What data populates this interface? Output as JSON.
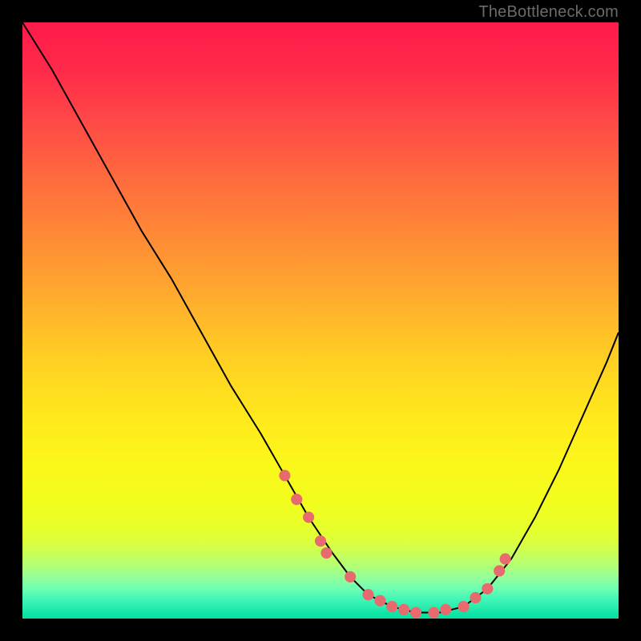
{
  "attribution": "TheBottleneck.com",
  "colors": {
    "frame": "#000000",
    "curve": "#000000",
    "dots": "#e76a6e",
    "gradient_top": "#ff1a4b",
    "gradient_bottom": "#05e0a2"
  },
  "chart_data": {
    "type": "line",
    "title": "",
    "xlabel": "",
    "ylabel": "",
    "xlim": [
      0,
      100
    ],
    "ylim": [
      0,
      100
    ],
    "grid": false,
    "legend": false,
    "series": [
      {
        "name": "bottleneck-curve",
        "x": [
          0,
          5,
          10,
          15,
          20,
          25,
          30,
          35,
          40,
          44,
          48,
          52,
          55,
          58,
          62,
          66,
          70,
          74,
          78,
          82,
          86,
          90,
          94,
          98,
          100
        ],
        "y": [
          100,
          92,
          83,
          74,
          65,
          57,
          48,
          39,
          31,
          24,
          17,
          11,
          7,
          4,
          2,
          1,
          1,
          2,
          5,
          10,
          17,
          25,
          34,
          43,
          48
        ]
      }
    ],
    "highlight_dots": {
      "name": "near-minimum-dots",
      "x": [
        44,
        46,
        48,
        50,
        51,
        55,
        58,
        60,
        62,
        64,
        66,
        69,
        71,
        74,
        76,
        78,
        80,
        81
      ],
      "y": [
        24,
        20,
        17,
        13,
        11,
        7,
        4,
        3,
        2,
        1.5,
        1,
        1,
        1.5,
        2,
        3.5,
        5,
        8,
        10
      ]
    }
  }
}
